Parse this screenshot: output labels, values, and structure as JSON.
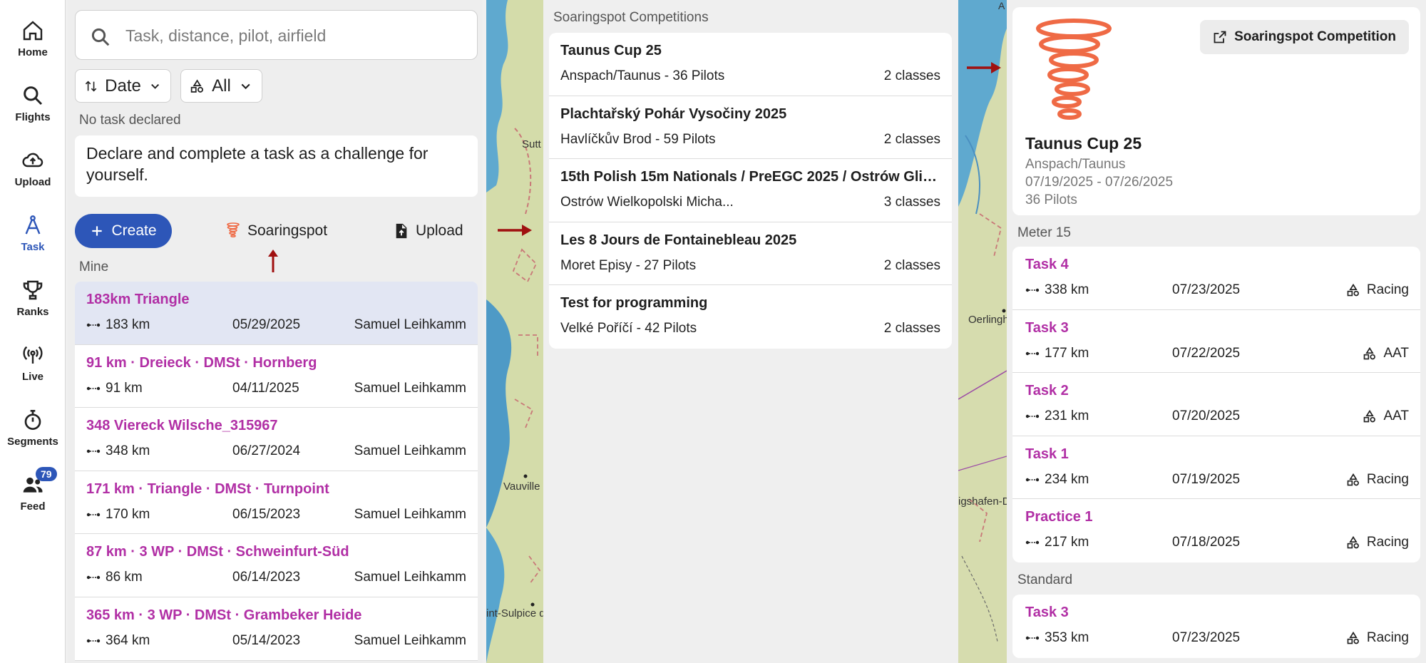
{
  "nav": {
    "items": [
      {
        "label": "Home",
        "icon": "home-icon"
      },
      {
        "label": "Flights",
        "icon": "search-icon"
      },
      {
        "label": "Upload",
        "icon": "cloud-upload-icon"
      },
      {
        "label": "Task",
        "icon": "compass-icon"
      },
      {
        "label": "Ranks",
        "icon": "trophy-icon"
      },
      {
        "label": "Live",
        "icon": "broadcast-icon"
      },
      {
        "label": "Segments",
        "icon": "stopwatch-icon"
      },
      {
        "label": "Feed",
        "icon": "people-icon"
      }
    ],
    "feed_badge": "79",
    "active": "Task"
  },
  "tasks_panel": {
    "search_placeholder": "Task, distance, pilot, airfield",
    "sort_label": "Date",
    "filter_label": "All",
    "no_task": "No task declared",
    "challenge_text": "Declare and complete a task as a challenge for yourself.",
    "create_label": "Create",
    "soaringspot_label": "Soaringspot",
    "upload_label": "Upload",
    "mine_label": "Mine",
    "tasks": [
      {
        "title": "183km Triangle",
        "distance": "183 km",
        "date": "05/29/2025",
        "pilot": "Samuel Leihkamm"
      },
      {
        "title": "91 km · Dreieck · DMSt · Hornberg",
        "distance": "91 km",
        "date": "04/11/2025",
        "pilot": "Samuel Leihkamm"
      },
      {
        "title": "348 Viereck Wilsche_315967",
        "distance": "348 km",
        "date": "06/27/2024",
        "pilot": "Samuel Leihkamm"
      },
      {
        "title": "171 km · Triangle · DMSt · Turnpoint",
        "distance": "170 km",
        "date": "06/15/2023",
        "pilot": "Samuel Leihkamm"
      },
      {
        "title": "87 km · 3 WP · DMSt · Schweinfurt-Süd",
        "distance": "86 km",
        "date": "06/14/2023",
        "pilot": "Samuel Leihkamm"
      },
      {
        "title": "365 km · 3 WP · DMSt · Grambeker Heide",
        "distance": "364 km",
        "date": "05/14/2023",
        "pilot": "Samuel Leihkamm"
      }
    ]
  },
  "map_labels": {
    "left_top": "Sutt",
    "left_mid": "Vauville",
    "left_bottom": "int-Sulpice d",
    "right_1": "Oerlingh",
    "right_2": "igshafen-D",
    "right_top": "A"
  },
  "competitions": {
    "header": "Soaringspot Competitions",
    "items": [
      {
        "title": "Taunus Cup 25",
        "location": "Anspach/Taunus - 36 Pilots",
        "classes": "2 classes"
      },
      {
        "title": "Plachtařský Pohár Vysočiny 2025",
        "location": "Havlíčkův Brod - 59 Pilots",
        "classes": "2 classes"
      },
      {
        "title": "15th Polish 15m Nationals / PreEGC 2025 / Ostrów Glide...",
        "location": "Ostrów Wielkopolski Micha...",
        "classes": "3 classes"
      },
      {
        "title": "Les 8 Jours de Fontainebleau 2025",
        "location": "Moret Episy - 27 Pilots",
        "classes": "2 classes"
      },
      {
        "title": "Test for programming",
        "location": "Velké Poříčí - 42 Pilots",
        "classes": "2 classes"
      }
    ]
  },
  "detail": {
    "external_button": "Soaringspot Competition",
    "title": "Taunus Cup 25",
    "location": "Anspach/Taunus",
    "dates": "07/19/2025 - 07/26/2025",
    "pilots": "36 Pilots",
    "class_1": {
      "label": "Meter 15",
      "tasks": [
        {
          "title": "Task 4",
          "distance": "338 km",
          "date": "07/23/2025",
          "kind": "Racing"
        },
        {
          "title": "Task 3",
          "distance": "177 km",
          "date": "07/22/2025",
          "kind": "AAT"
        },
        {
          "title": "Task 2",
          "distance": "231 km",
          "date": "07/20/2025",
          "kind": "AAT"
        },
        {
          "title": "Task 1",
          "distance": "234 km",
          "date": "07/19/2025",
          "kind": "Racing"
        },
        {
          "title": "Practice 1",
          "distance": "217 km",
          "date": "07/18/2025",
          "kind": "Racing"
        }
      ]
    },
    "class_2": {
      "label": "Standard",
      "tasks": [
        {
          "title": "Task 3",
          "distance": "353 km",
          "date": "07/23/2025",
          "kind": "Racing"
        }
      ]
    }
  },
  "colors": {
    "accent": "#2d56b8",
    "task_title": "#b12fa5",
    "arrow": "#a01010",
    "soaringspot": "#ef6a45"
  }
}
